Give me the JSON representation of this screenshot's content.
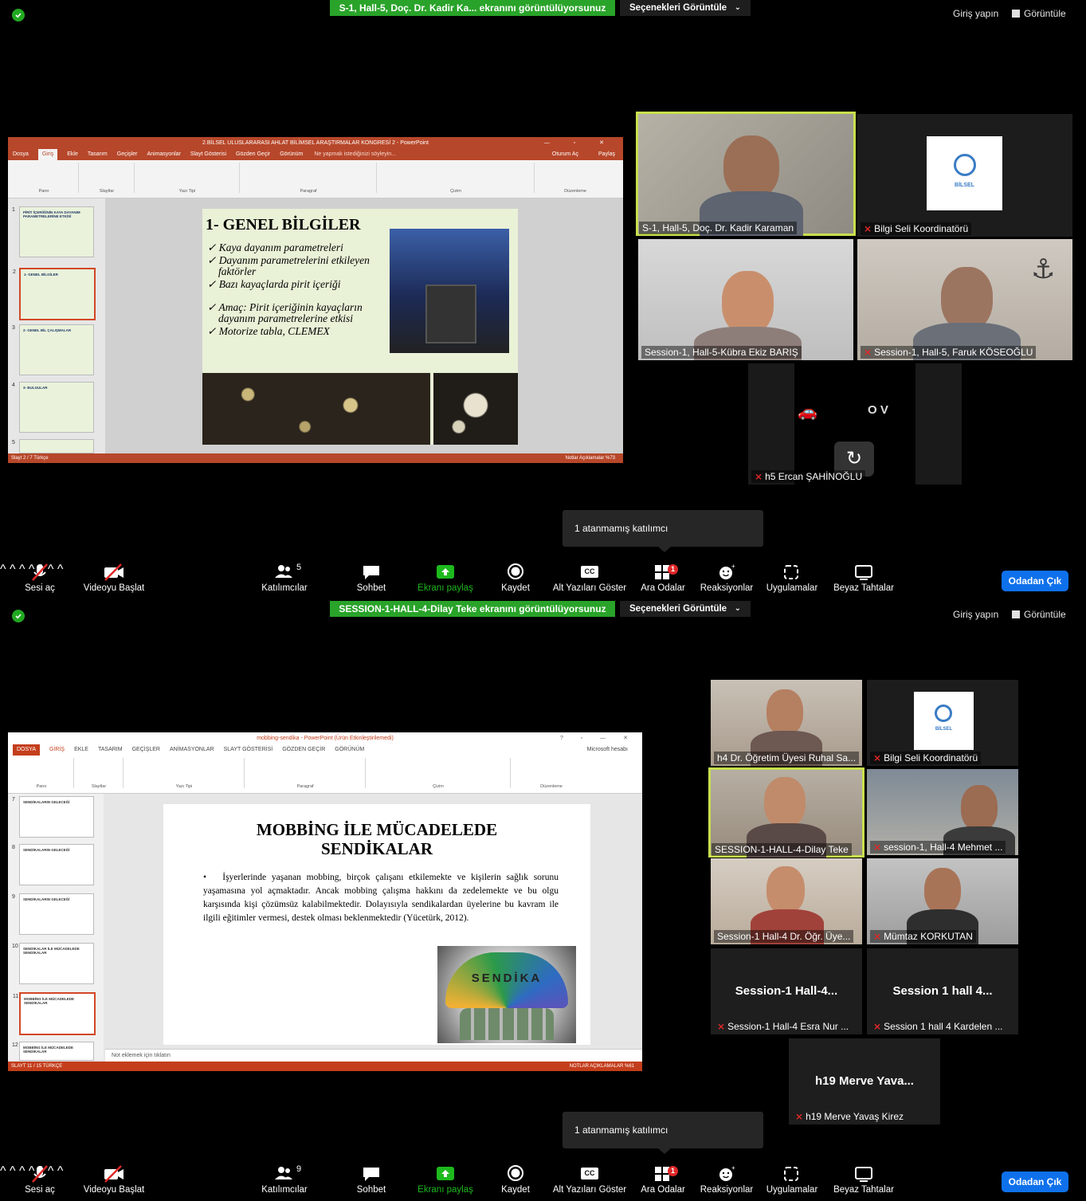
{
  "screen1": {
    "banner": "S-1, Hall-5, Doç. Dr. Kadir Ka... ekranını görüntülüyorsunuz",
    "view_options": "Seçenekleri Görüntüle",
    "login": "Giriş yapın",
    "view": "Görüntüle",
    "ppt": {
      "title": "2.BİLSEL ULUSLARARASI AHLAT BİLİMSEL ARAŞTIRMALAR KONGRESİ 2 - PowerPoint",
      "tabs": [
        "Dosya",
        "Giriş",
        "Ekle",
        "Tasarım",
        "Geçişler",
        "Animasyonlar",
        "Slayt Gösterisi",
        "Gözden Geçir",
        "Görünüm"
      ],
      "tell_me": "Ne yapmak istediğinizi söyleyin...",
      "sign_in": "Oturum Aç",
      "share": "Paylaş",
      "groups": [
        "Pano",
        "Slaytlar",
        "Yazı Tipi",
        "Paragraf",
        "Çizim",
        "Düzenleme"
      ],
      "status_left": "Slayt 2 / 7    Türkçe",
      "status_right": "Notlar   Açıklamalar   %73",
      "thumbs": [
        {
          "num": "1",
          "title": "PİRİT İÇERİĞİNİN KAYA DAYANIM PARAMETRELERİNE ETKİSİ"
        },
        {
          "num": "2",
          "title": "1- GENEL BİLGİLER"
        },
        {
          "num": "3",
          "title": "2- GENEL BİL ÇALIŞMALAR"
        },
        {
          "num": "4",
          "title": "3- BULGULAR"
        },
        {
          "num": "5",
          "title": ""
        }
      ],
      "slide": {
        "heading": "1- GENEL BİLGİLER",
        "bullets": [
          "Kaya dayanım parametreleri",
          "Dayanım parametrelerini etkileyen faktörler",
          "Bazı kayaçlarda pirit içeriği",
          "Amaç: Pirit içeriğinin kayaçların dayanım parametrelerine etkisi",
          "Motorize tabla, CLEMEX"
        ]
      }
    },
    "tiles": [
      {
        "name": "S-1, Hall-5, Doç. Dr. Kadir Karaman",
        "muted": false
      },
      {
        "name": "Bilgi Seli Koordinatörü",
        "muted": true,
        "logo": "BİLSEL"
      },
      {
        "name": "Session-1, Hall-5-Kübra Ekiz BARIŞ",
        "muted": false
      },
      {
        "name": "Session-1, Hall-5, Faruk KÖSEOĞLU",
        "muted": true
      },
      {
        "name": "h5 Ercan ŞAHİNOĞLU",
        "muted": true
      }
    ],
    "tooltip": "1 atanmamış katılımcı",
    "participants_count": "5"
  },
  "screen2": {
    "banner": "SESSION-1-HALL-4-Dilay Teke ekranını görüntülüyorsunuz",
    "view_options": "Seçenekleri Görüntüle",
    "login": "Giriş yapın",
    "view": "Görüntüle",
    "ppt": {
      "title": "mobbing-sendika - PowerPoint (Ürün Etkinleştirilemedi)",
      "tabs": [
        "DOSYA",
        "GİRİŞ",
        "EKLE",
        "TASARIM",
        "GEÇİŞLER",
        "ANİMASYONLAR",
        "SLAYT GÖSTERİSİ",
        "GÖZDEN GEÇİR",
        "GÖRÜNÜM"
      ],
      "account": "Microsoft hesabı",
      "groups": [
        "Pano",
        "Slaytlar",
        "Yazı Tipi",
        "Paragraf",
        "Çizim",
        "Düzenleme"
      ],
      "status_left": "SLAYT 11 / 15    TÜRKÇE",
      "status_right": "NOTLAR   AÇIKLAMALAR   %61",
      "notes_hint": "Not eklemek için tıklatın",
      "thumbs": [
        {
          "num": "7",
          "title": "SENDİKALARIN GELECEĞİ"
        },
        {
          "num": "8",
          "title": "SENDİKALARIN GELECEĞİ"
        },
        {
          "num": "9",
          "title": "SENDİKALARIN GELECEĞİ"
        },
        {
          "num": "10",
          "title": "SENDİKALAR İLE MÜCADELEDE SENDİKALAR"
        },
        {
          "num": "11",
          "title": "MOBBİNG İLE MÜCADELEDE SENDİKALAR"
        },
        {
          "num": "12",
          "title": "MOBBİNG İLE MÜCADELEDE SENDİKALAR"
        }
      ],
      "slide": {
        "heading_line1": "MOBBİNG İLE MÜCADELEDE",
        "heading_line2": "SENDİKALAR",
        "body": "İşyerlerinde yaşanan mobbing, birçok çalışanı etkilemekte ve kişilerin sağlık sorunu yaşamasına yol açmaktadır. Ancak mobbing çalışma hakkını da zedelemekte ve bu olgu karşısında kişi çözümsüz kalabilmektedir. Dolayısıyla sendikalardan üyelerine bu kavram ile ilgili eğitimler vermesi, destek olması beklenmektedir (Yücetürk, 2012).",
        "umbrella_text": "SENDİKA"
      }
    },
    "tiles": [
      {
        "name": "h4 Dr. Öğretim Üyesi Ruhal Sa...",
        "muted": false
      },
      {
        "name": "Bilgi Seli Koordinatörü",
        "muted": true,
        "logo": "BİLSEL"
      },
      {
        "name": "SESSION-1-HALL-4-Dilay Teke",
        "muted": false
      },
      {
        "name": "session-1, Hall-4 Mehmet ...",
        "muted": true
      },
      {
        "name": "Session-1 Hall-4 Dr. Öğr. Üye...",
        "muted": false
      },
      {
        "name": "Mümtaz KORKUTAN",
        "muted": true
      },
      {
        "name": "Session-1 Hall-4 Esra Nur ...",
        "muted": true,
        "center": "Session-1  Hall-4..."
      },
      {
        "name": "Session 1 hall 4 Kardelen ...",
        "muted": true,
        "center": "Session 1 hall 4..."
      },
      {
        "name": "h19 Merve Yavaş Kirez",
        "muted": true,
        "center": "h19 Merve Yava..."
      }
    ],
    "tooltip": "1 atanmamış katılımcı",
    "participants_count": "9"
  },
  "toolbar": {
    "unmute": "Sesi aç",
    "start_video": "Videoyu Başlat",
    "participants": "Katılımcılar",
    "chat": "Sohbet",
    "share_screen": "Ekranı paylaş",
    "record": "Kaydet",
    "captions": "Alt Yazıları Göster",
    "breakout": "Ara Odalar",
    "breakout_badge": "1",
    "reactions": "Reaksiyonlar",
    "apps": "Uygulamalar",
    "whiteboards": "Beyaz Tahtalar",
    "leave": "Odadan Çık",
    "cc_icon": "CC"
  },
  "colors": {
    "banner_green": "#29a329",
    "leave_blue": "#0e71eb",
    "active_speaker": "#c9e04e",
    "ppt_red": "#d24726",
    "ppt_red_2013": "#c43e1c",
    "mic_off": "#e02828"
  }
}
